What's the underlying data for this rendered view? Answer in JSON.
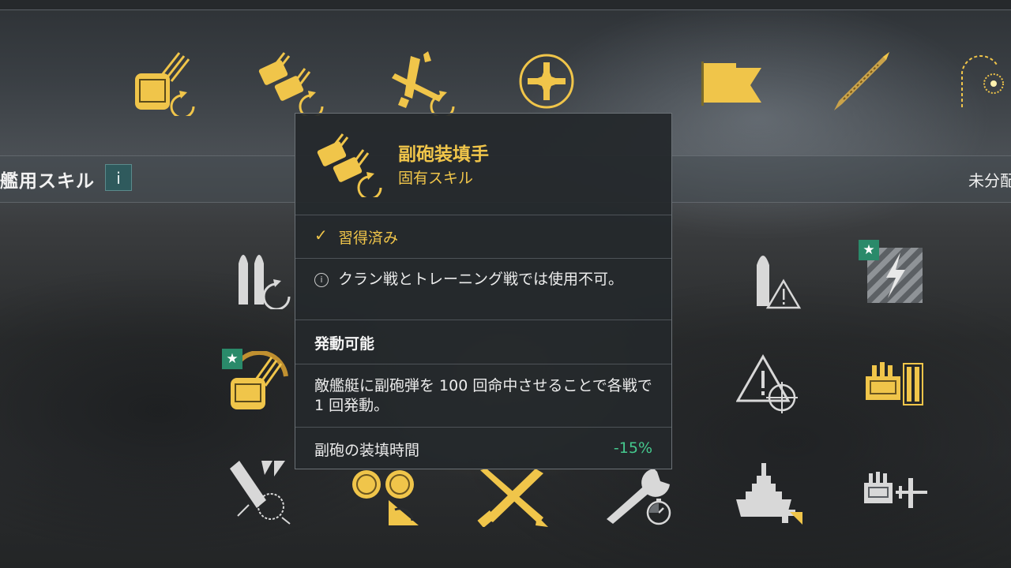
{
  "section": {
    "title": "艦用スキル",
    "info": "i",
    "unallocated": "未分配"
  },
  "tooltip": {
    "skill_name": "副砲装填手",
    "skill_type": "固有スキル",
    "acquired": "習得済み",
    "note": "クラン戦とトレーニング戦では使用不可。",
    "trigger_heading": "発動可能",
    "trigger_desc": "敵艦艇に副砲弾を 100 回命中させることで各戦で 1 回発動。",
    "stat_label": "副砲の装填時間",
    "stat_value": "-15%"
  },
  "badges": {
    "star": "★"
  },
  "colors": {
    "gold": "#f0c54a",
    "inactive": "#d8d8d8",
    "positive": "#45c98e",
    "badge": "#2a8a6a"
  },
  "icons": {
    "top_row": [
      "main-battery-reload-icon",
      "secondary-reload-icon",
      "aircraft-reload-icon",
      "cross-emblem-icon",
      "signal-flag-icon",
      "torpedo-icon",
      "fire-burst-icon"
    ],
    "bottom_row": [
      "shell-reload-icon",
      "shell-warning-icon",
      "electric-hazard-icon",
      "gun-reload-star-icon",
      "warning-target-icon",
      "aa-battery-icon",
      "broken-shell-icon",
      "secondary-reload-alt-icon",
      "crossed-guns-icon",
      "wrench-timer-icon",
      "battleship-repair-icon",
      "aa-aircraft-icon"
    ]
  }
}
